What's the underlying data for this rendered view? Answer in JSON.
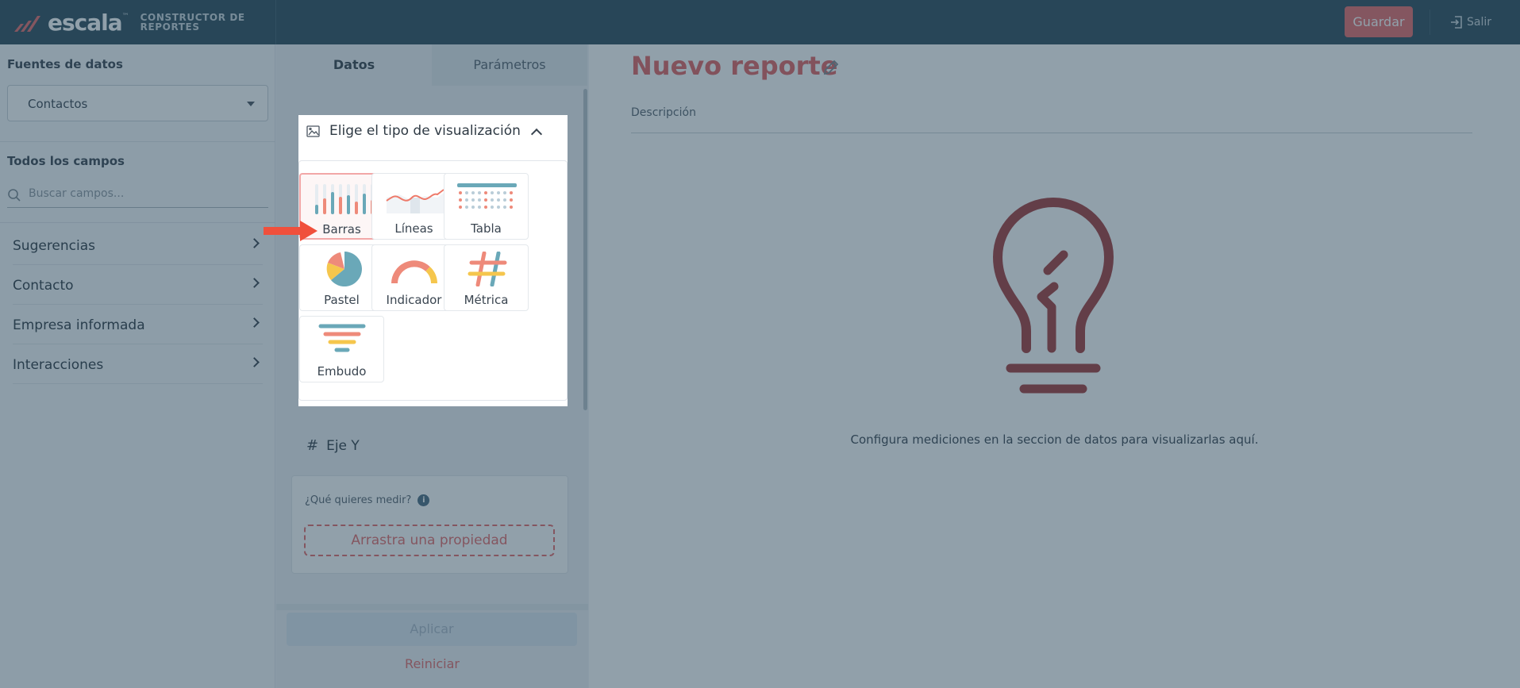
{
  "header": {
    "brand": "escala",
    "brand_tm": "™",
    "subtitle": "CONSTRUCTOR DE REPORTES",
    "save_label": "Guardar",
    "exit_label": "Salir"
  },
  "sidebar": {
    "datasource_title": "Fuentes de datos",
    "datasource_value": "Contactos",
    "fields_title": "Todos los campos",
    "search_placeholder": "Buscar campos...",
    "categories": [
      {
        "label": "Sugerencias"
      },
      {
        "label": "Contacto"
      },
      {
        "label": "Empresa informada"
      },
      {
        "label": "Interacciones"
      }
    ]
  },
  "panel": {
    "tabs": [
      {
        "label": "Datos",
        "active": true
      },
      {
        "label": "Parámetros",
        "active": false
      }
    ],
    "viz_title": "Elige el tipo de visualización",
    "viz_types": [
      {
        "label": "Barras",
        "icon": "bar-chart-icon",
        "selected": true
      },
      {
        "label": "Líneas",
        "icon": "line-chart-icon",
        "selected": false
      },
      {
        "label": "Tabla",
        "icon": "table-icon",
        "selected": false
      },
      {
        "label": "Pastel",
        "icon": "pie-chart-icon",
        "selected": false
      },
      {
        "label": "Indicador",
        "icon": "gauge-icon",
        "selected": false
      },
      {
        "label": "Métrica",
        "icon": "hash-icon",
        "selected": false
      },
      {
        "label": "Embudo",
        "icon": "funnel-icon",
        "selected": false
      }
    ],
    "y_axis_label": "Eje Y",
    "measure_question": "¿Qué quieres medir?",
    "dropzone_label": "Arrastra una propiedad",
    "apply_label": "Aplicar",
    "reset_label": "Reiniciar"
  },
  "main": {
    "title": "Nuevo reporte",
    "description_label": "Descripción",
    "empty_message": "Configura mediciones en la seccion de datos para visualizarlas aquí."
  },
  "colors": {
    "header_bg": "#2c4a5a",
    "accent": "#e56a6a",
    "title": "#e06363",
    "teal": "#6aa8b8",
    "yellow": "#f5c64d"
  }
}
